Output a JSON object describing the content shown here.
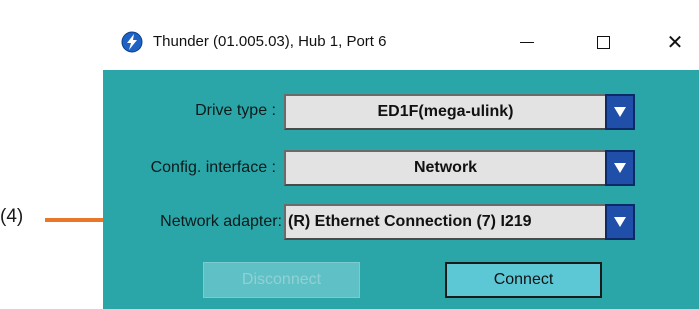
{
  "annotation": {
    "label": "(4)",
    "color": "#e8762b"
  },
  "window": {
    "title": "Thunder (01.005.03), Hub 1, Port 6",
    "icon": "lightning-bolt-icon",
    "controls": {
      "minimize": "minimize-icon",
      "maximize": "maximize-icon",
      "close": "close-icon"
    },
    "background": "#2aa6a8"
  },
  "fields": {
    "drive_type": {
      "label": "Drive type :",
      "value": "ED1F(mega-ulink)"
    },
    "config_interface": {
      "label": "Config. interface :",
      "value": "Network"
    },
    "network_adapter": {
      "label": "Network adapter:",
      "value": "(R) Ethernet Connection (7) I219"
    }
  },
  "buttons": {
    "disconnect": {
      "label": "Disconnect",
      "enabled": false
    },
    "connect": {
      "label": "Connect",
      "enabled": true
    }
  },
  "colors": {
    "dropdown_arrow": "#1f4fa8",
    "teal": "#2aa6a8"
  }
}
